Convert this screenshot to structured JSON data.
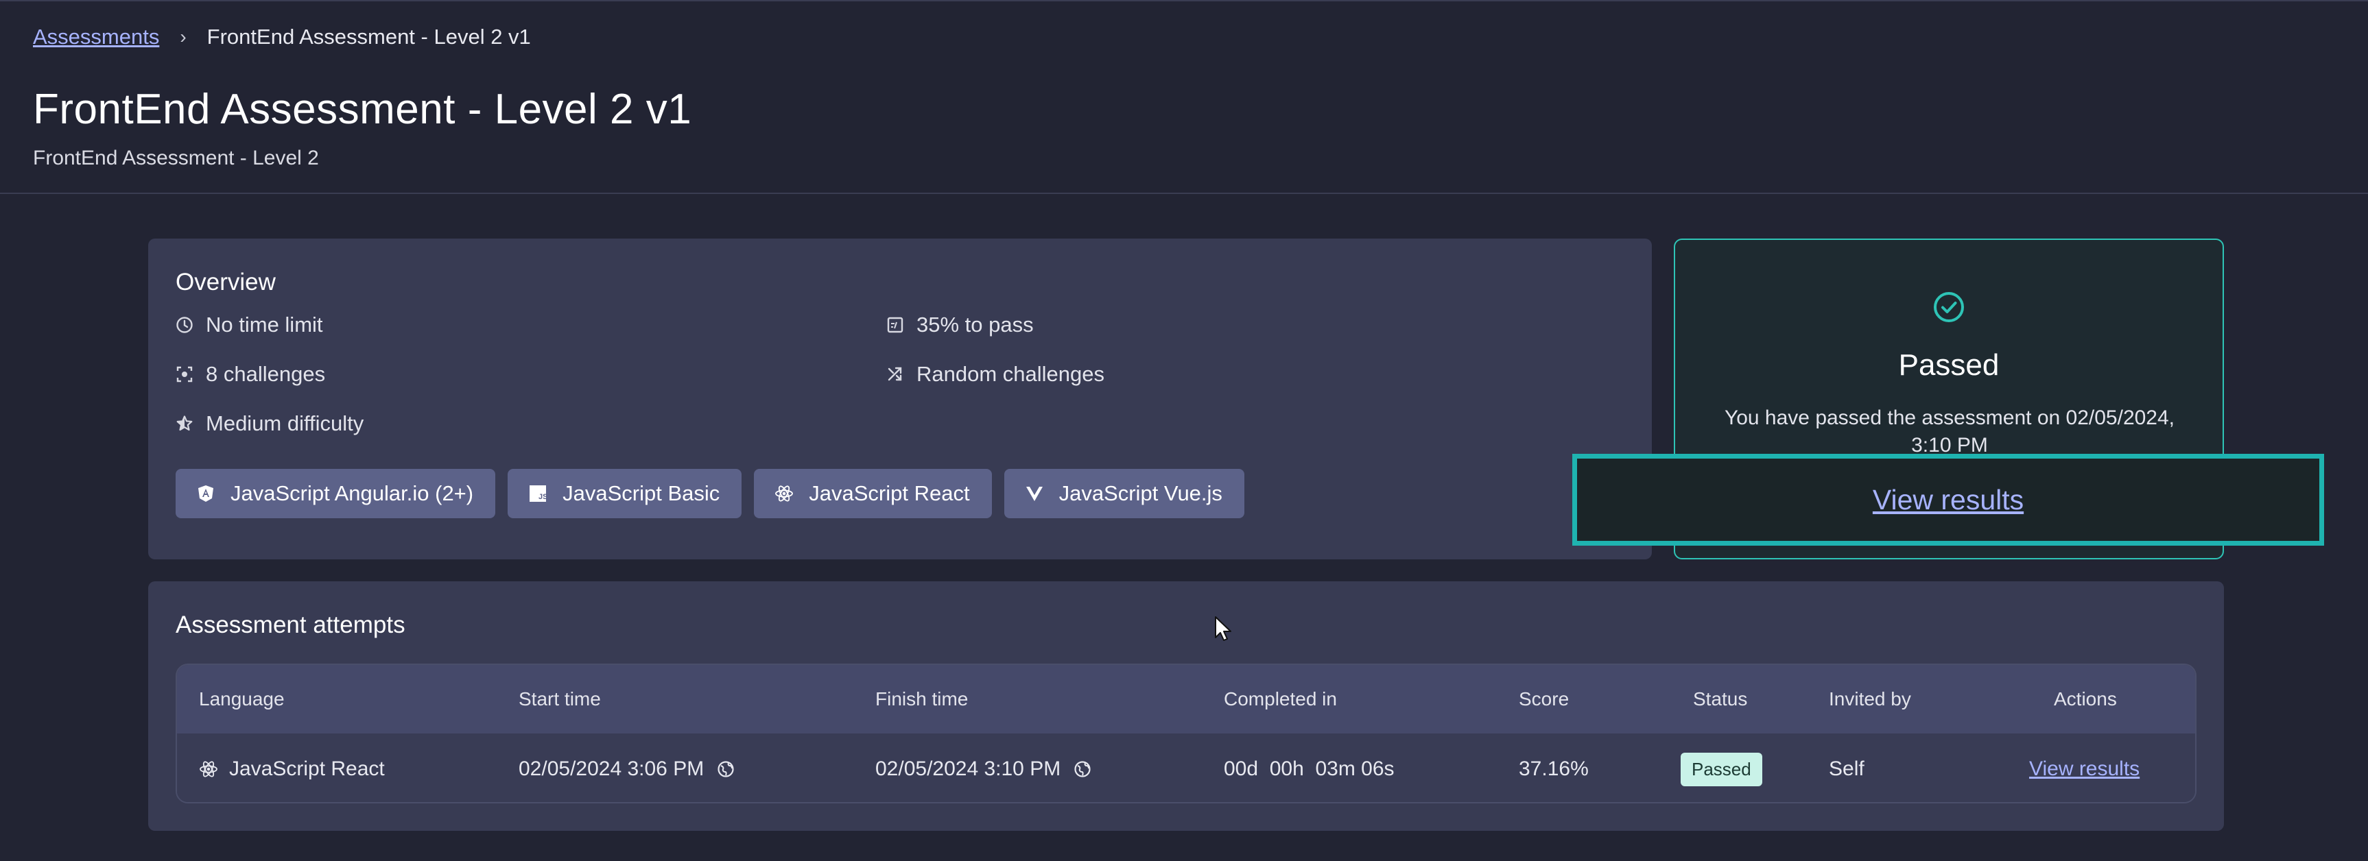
{
  "breadcrumb": {
    "root": "Assessments",
    "current": "FrontEnd Assessment - Level 2 v1"
  },
  "page": {
    "title": "FrontEnd Assessment - Level 2 v1",
    "subtitle": "FrontEnd Assessment - Level 2"
  },
  "overview": {
    "title": "Overview",
    "items": [
      {
        "icon": "clock-icon",
        "text": "No time limit"
      },
      {
        "icon": "percent-icon",
        "text": "35% to pass"
      },
      {
        "icon": "challenges-icon",
        "text": "8 challenges"
      },
      {
        "icon": "shuffle-icon",
        "text": "Random challenges"
      },
      {
        "icon": "star-icon",
        "text": "Medium difficulty"
      }
    ],
    "tags": [
      {
        "icon": "angular-icon",
        "label": "JavaScript Angular.io (2+)"
      },
      {
        "icon": "javascript-icon",
        "label": "JavaScript Basic"
      },
      {
        "icon": "react-icon",
        "label": "JavaScript React"
      },
      {
        "icon": "vue-icon",
        "label": "JavaScript Vue.js"
      }
    ]
  },
  "result": {
    "status": "Passed",
    "message": "You have passed the assessment on 02/05/2024, 3:10 PM",
    "link": "View results",
    "accent": "#2ec4b6"
  },
  "attempts": {
    "title": "Assessment attempts",
    "columns": [
      "Language",
      "Start time",
      "Finish time",
      "Completed in",
      "Score",
      "Status",
      "Invited by",
      "Actions"
    ],
    "rows": [
      {
        "language": "JavaScript React",
        "start": "02/05/2024 3:06 PM",
        "finish": "02/05/2024 3:10 PM",
        "completed": "00d  00h  03m 06s",
        "score": "37.16%",
        "status": "Passed",
        "invited_by": "Self",
        "action": "View results"
      }
    ]
  }
}
